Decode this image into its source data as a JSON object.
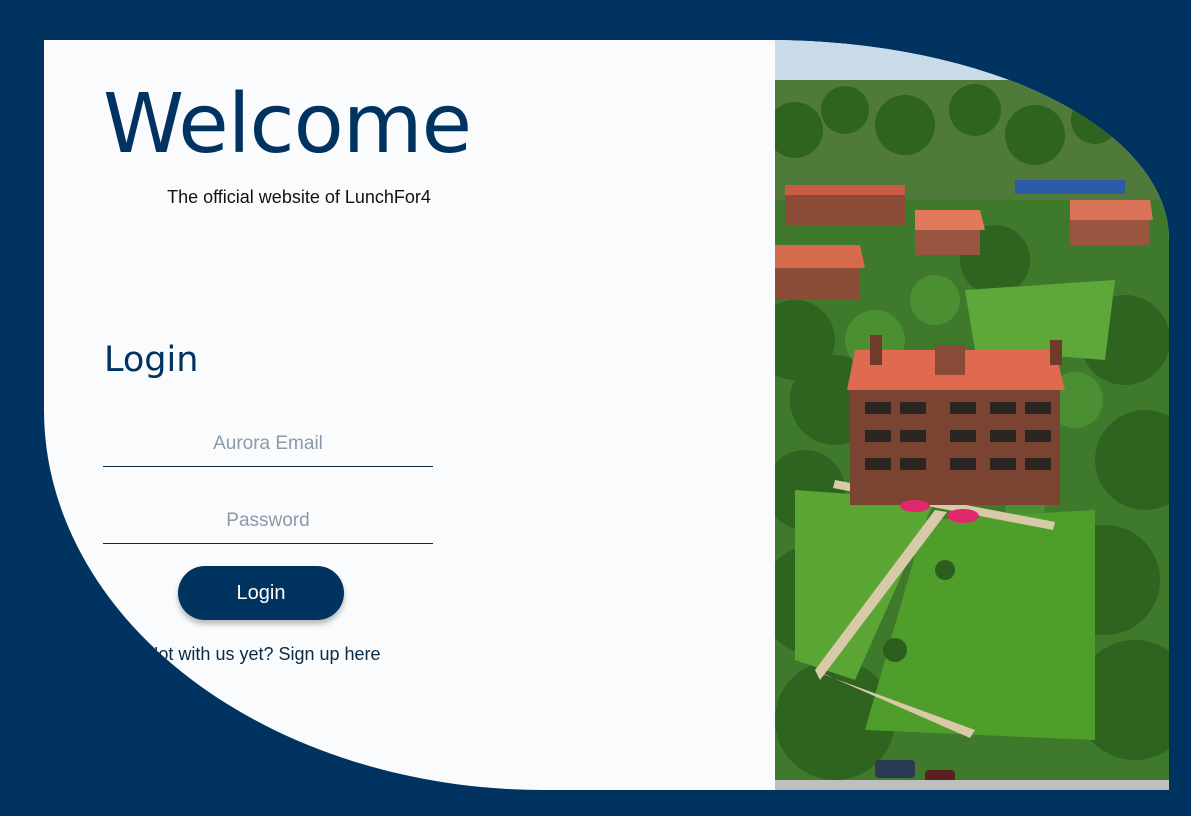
{
  "welcome": {
    "title": "Welcome",
    "subtitle": "The official website of LunchFor4"
  },
  "login": {
    "heading": "Login",
    "email_placeholder": "Aurora Email",
    "password_placeholder": "Password",
    "button_label": "Login",
    "signup_link": "Not with us yet? Sign up here"
  },
  "colors": {
    "brand": "#003360",
    "card_background": "#fafbfd"
  }
}
